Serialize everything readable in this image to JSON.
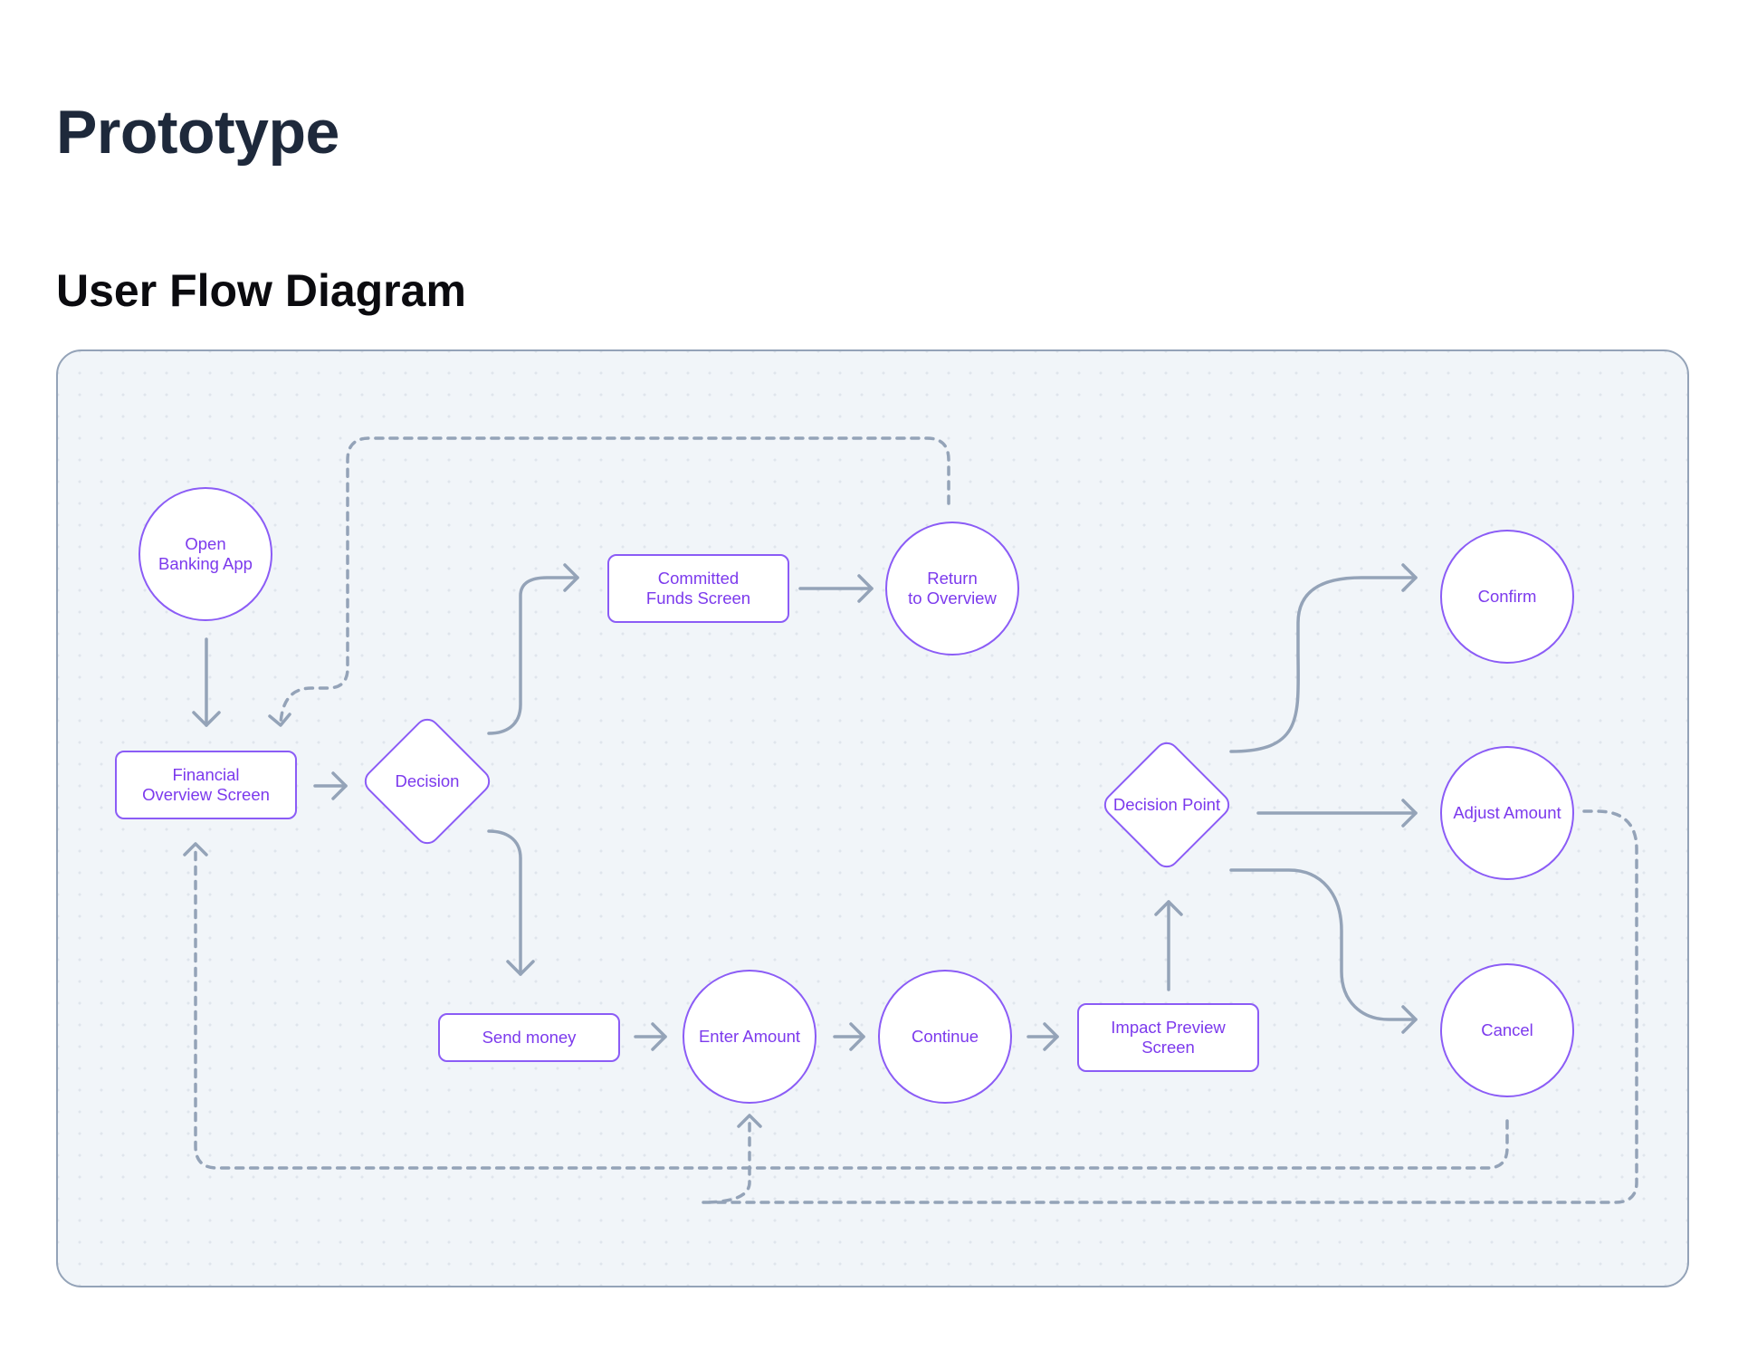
{
  "page": {
    "title": "Prototype",
    "section_title": "User Flow Diagram"
  },
  "colors": {
    "node_border": "#8b5cf6",
    "node_text": "#7c3aed",
    "edge": "#94a3b8",
    "canvas_background": "#f1f5f9",
    "title": "#1e293b"
  },
  "diagram": {
    "nodes": {
      "open_banking_app": {
        "label": "Open\nBanking App",
        "shape": "circle"
      },
      "financial_overview": {
        "label": "Financial\nOverview Screen",
        "shape": "rectangle"
      },
      "decision": {
        "label": "Decision",
        "shape": "diamond"
      },
      "committed_funds": {
        "label": "Committed\nFunds Screen",
        "shape": "rectangle"
      },
      "return_to_overview": {
        "label": "Return\nto Overview",
        "shape": "circle"
      },
      "send_money": {
        "label": "Send money",
        "shape": "rectangle"
      },
      "enter_amount": {
        "label": "Enter Amount",
        "shape": "circle"
      },
      "continue": {
        "label": "Continue",
        "shape": "circle"
      },
      "impact_preview": {
        "label": "Impact Preview\nScreen",
        "shape": "rectangle"
      },
      "decision_point": {
        "label": "Decision Point",
        "shape": "diamond"
      },
      "confirm": {
        "label": "Confirm",
        "shape": "circle"
      },
      "adjust_amount": {
        "label": "Adjust Amount",
        "shape": "circle"
      },
      "cancel": {
        "label": "Cancel",
        "shape": "circle"
      }
    },
    "edges": [
      {
        "from": "open_banking_app",
        "to": "financial_overview",
        "style": "solid"
      },
      {
        "from": "financial_overview",
        "to": "decision",
        "style": "solid"
      },
      {
        "from": "decision",
        "to": "committed_funds",
        "style": "solid"
      },
      {
        "from": "decision",
        "to": "send_money",
        "style": "solid"
      },
      {
        "from": "committed_funds",
        "to": "return_to_overview",
        "style": "solid"
      },
      {
        "from": "return_to_overview",
        "to": "financial_overview",
        "style": "dashed"
      },
      {
        "from": "send_money",
        "to": "enter_amount",
        "style": "solid"
      },
      {
        "from": "enter_amount",
        "to": "continue",
        "style": "solid"
      },
      {
        "from": "continue",
        "to": "impact_preview",
        "style": "solid"
      },
      {
        "from": "impact_preview",
        "to": "decision_point",
        "style": "solid"
      },
      {
        "from": "decision_point",
        "to": "confirm",
        "style": "solid"
      },
      {
        "from": "decision_point",
        "to": "adjust_amount",
        "style": "solid"
      },
      {
        "from": "decision_point",
        "to": "cancel",
        "style": "solid"
      },
      {
        "from": "adjust_amount",
        "to": "enter_amount",
        "style": "dashed"
      },
      {
        "from": "cancel",
        "to": "financial_overview",
        "style": "dashed"
      }
    ]
  }
}
